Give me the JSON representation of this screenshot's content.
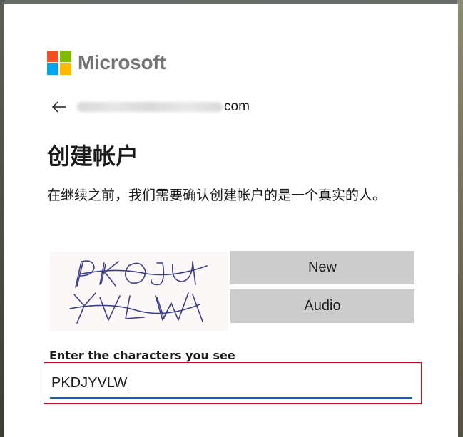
{
  "brand": {
    "name": "Microsoft",
    "colors": {
      "red": "#f25022",
      "green": "#7fba00",
      "blue": "#00a4ef",
      "yellow": "#ffb900"
    }
  },
  "identity": {
    "email_suffix": "com",
    "back_icon": "arrow-left-icon"
  },
  "page": {
    "title": "创建帐户",
    "description": "在继续之前，我们需要确认创建帐户的是一个真实的人。"
  },
  "captcha": {
    "image_text": "PKDJYVLW",
    "new_button": "New",
    "audio_button": "Audio",
    "input_label": "Enter the characters you see",
    "input_value": "PKDJYVLW"
  },
  "colors": {
    "error_border": "#c50f1f",
    "input_underline": "#0067b8",
    "button_bg": "#cccccc"
  }
}
